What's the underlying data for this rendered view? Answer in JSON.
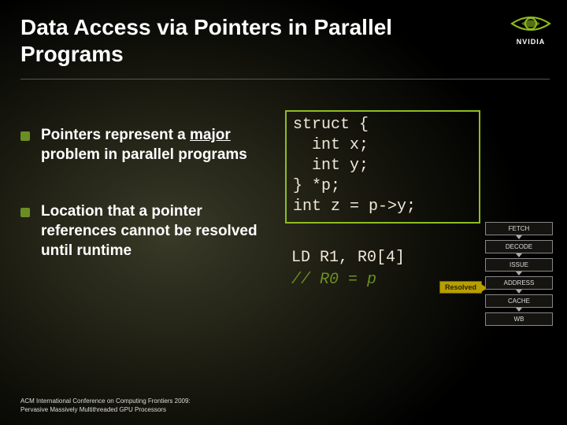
{
  "title": "Data Access via Pointers in Parallel Programs",
  "brand": "NVIDIA",
  "bullets": [
    {
      "pre": "Pointers represent a ",
      "under": "major",
      "post": " problem in parallel programs"
    },
    {
      "pre": "",
      "under": "",
      "post": "Location that a pointer references cannot be resolved until runtime"
    }
  ],
  "code": {
    "l1": "struct {",
    "l2": "  int x;",
    "l3": "  int y;",
    "l4": "} *p;",
    "l5": "int z = p->y;"
  },
  "asm": {
    "line": "LD R1, R0[4]",
    "comment": "   // R0 = p"
  },
  "pipeline": [
    "FETCH",
    "DECODE",
    "ISSUE",
    "ADDRESS",
    "CACHE",
    "WB"
  ],
  "resolved_label": "Resolved",
  "footer": {
    "l1": "ACM International Conference on Computing Frontiers 2009:",
    "l2": "Pervasive Massively Multithreaded GPU Processors"
  }
}
